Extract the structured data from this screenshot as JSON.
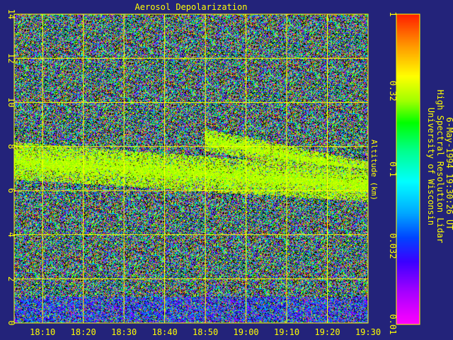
{
  "colors": {
    "background": "#23237a",
    "axis": "#ffff00",
    "grid": "#ffff00",
    "text": "#ffff00"
  },
  "chart_data": {
    "type": "heatmap",
    "title": "Aerosol Depolarization",
    "ylabel": "Altitude (km)",
    "xlabel": "",
    "grid": true,
    "x_ticks": [
      "18:10",
      "18:20",
      "18:30",
      "18:40",
      "18:50",
      "19:00",
      "19:10",
      "19:20",
      "19:30"
    ],
    "x_range": [
      "18:03",
      "19:30"
    ],
    "y_ticks": [
      0,
      2,
      4,
      6,
      8,
      10,
      12,
      14
    ],
    "ylim": [
      0,
      14
    ],
    "colorbar": {
      "scale": "log",
      "range": [
        0.01,
        1
      ],
      "ticks": [
        "1",
        "0.32",
        "0.1",
        "0.032",
        "0.01"
      ],
      "tick_values": [
        1,
        0.32,
        0.1,
        0.032,
        0.01
      ]
    },
    "layers": [
      {
        "start": "18:03",
        "end": "19:30",
        "base_start_km": 6.5,
        "top_start_km": 8.2,
        "base_end_km": 5.5,
        "top_end_km": 7.0,
        "depolarization": 0.3
      },
      {
        "start": "18:50",
        "end": "19:30",
        "base_start_km": 7.8,
        "top_start_km": 8.8,
        "base_end_km": 6.5,
        "top_end_km": 7.3,
        "depolarization": 0.3
      }
    ],
    "background_depolarization_range": [
      0.01,
      1
    ],
    "near_surface_depolarization": 0.03
  },
  "annotation": {
    "line1": "University of Wisconsin",
    "line2": "High Spectral Resolution Lidar",
    "line3": "6-May-1994 19:30:26 UT"
  }
}
